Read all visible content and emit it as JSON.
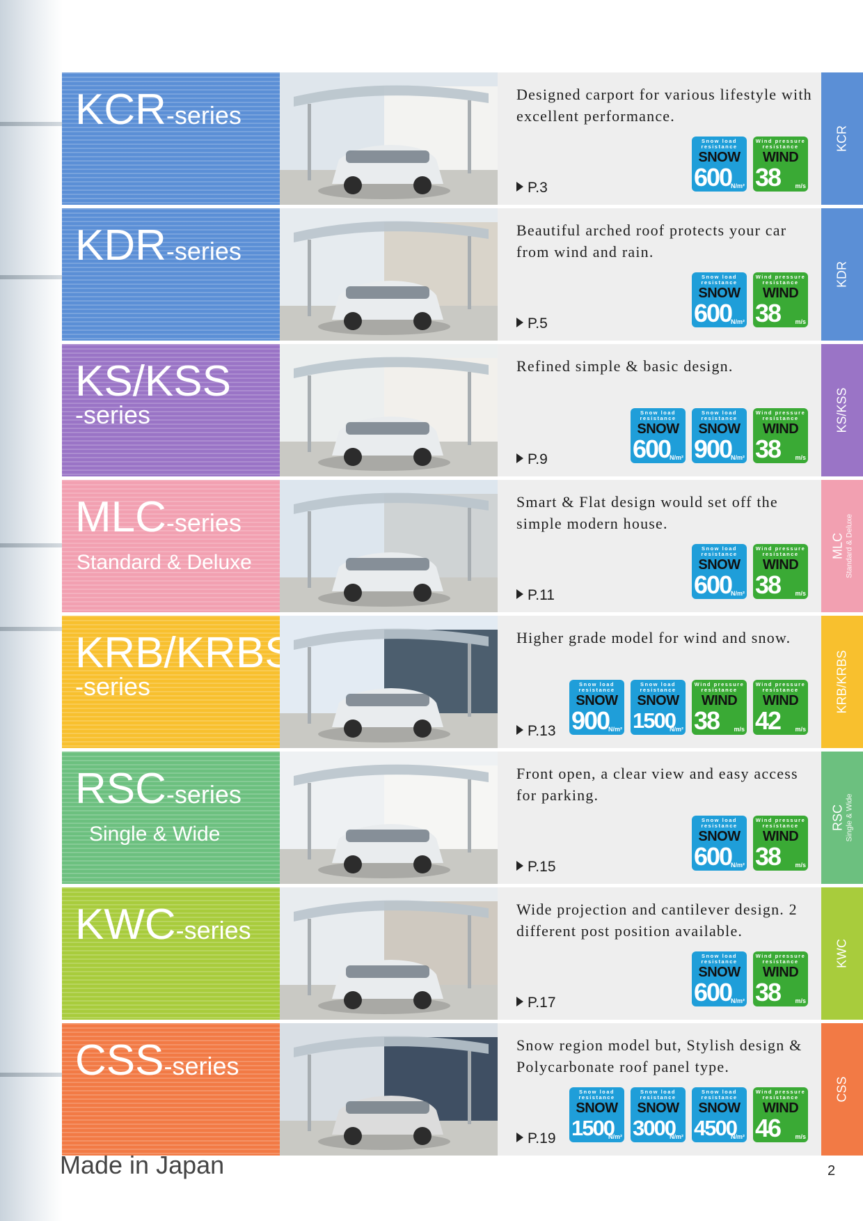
{
  "series": [
    {
      "name": "KCR",
      "suffix": "-series",
      "suffix_break": false,
      "subtitle": "",
      "tab": "KCR",
      "tab_sub": "",
      "color": "#5b8fd6",
      "description": "Designed carport for various lifestyle with excellent performance.",
      "page_ref": "P.3",
      "badges": [
        {
          "type": "snow",
          "caption": "Snow load resistance",
          "kind": "SNOW",
          "value": "600",
          "unit": "N/m²"
        },
        {
          "type": "wind",
          "caption": "Wind pressure resistance",
          "kind": "WIND",
          "value": "38",
          "unit": "m/s"
        }
      ]
    },
    {
      "name": "KDR",
      "suffix": "-series",
      "suffix_break": false,
      "subtitle": "",
      "tab": "KDR",
      "tab_sub": "",
      "color": "#5b8fd6",
      "description": "Beautiful arched roof protects your car from wind and rain.",
      "page_ref": "P.5",
      "badges": [
        {
          "type": "snow",
          "caption": "Snow load resistance",
          "kind": "SNOW",
          "value": "600",
          "unit": "N/m²"
        },
        {
          "type": "wind",
          "caption": "Wind pressure resistance",
          "kind": "WIND",
          "value": "38",
          "unit": "m/s"
        }
      ]
    },
    {
      "name": "KS/KSS",
      "suffix": "-series",
      "suffix_break": true,
      "subtitle": "",
      "tab": "KS/KSS",
      "tab_sub": "",
      "color": "#9a74c6",
      "description": "Refined simple & basic design.",
      "page_ref": "P.9",
      "badges": [
        {
          "type": "snow",
          "caption": "Snow load resistance",
          "kind": "SNOW",
          "value": "600",
          "unit": "N/m²"
        },
        {
          "type": "snow",
          "caption": "Snow load resistance",
          "kind": "SNOW",
          "value": "900",
          "unit": "N/m²"
        },
        {
          "type": "wind",
          "caption": "Wind pressure resistance",
          "kind": "WIND",
          "value": "38",
          "unit": "m/s"
        }
      ]
    },
    {
      "name": "MLC",
      "suffix": "-series",
      "suffix_break": false,
      "subtitle": "Standard & Deluxe",
      "tab": "MLC",
      "tab_sub": "Standard & Deluxe",
      "color": "#f2a0b1",
      "description": "Smart & Flat design would set off the simple modern house.",
      "page_ref": "P.11",
      "badges": [
        {
          "type": "snow",
          "caption": "Snow load resistance",
          "kind": "SNOW",
          "value": "600",
          "unit": "N/m²"
        },
        {
          "type": "wind",
          "caption": "Wind pressure resistance",
          "kind": "WIND",
          "value": "38",
          "unit": "m/s"
        }
      ]
    },
    {
      "name": "KRB/KRBS",
      "suffix": "-series",
      "suffix_break": true,
      "subtitle": "",
      "tab": "KRB/KRBS",
      "tab_sub": "",
      "color": "#f8c02e",
      "description": "Higher grade model for wind and snow.",
      "page_ref": "P.13",
      "badges": [
        {
          "type": "snow",
          "caption": "Snow load resistance",
          "kind": "SNOW",
          "value": "900",
          "unit": "N/m²"
        },
        {
          "type": "snow",
          "caption": "Snow load resistance",
          "kind": "SNOW",
          "value": "1500",
          "unit": "N/m²"
        },
        {
          "type": "wind",
          "caption": "Wind pressure resistance",
          "kind": "WIND",
          "value": "38",
          "unit": "m/s"
        },
        {
          "type": "wind",
          "caption": "Wind pressure resistance",
          "kind": "WIND",
          "value": "42",
          "unit": "m/s"
        }
      ]
    },
    {
      "name": "RSC",
      "suffix": "-series",
      "suffix_break": false,
      "subtitle": "Single & Wide",
      "tab": "RSC",
      "tab_sub": "Single & Wide",
      "color": "#6cc07f",
      "description": "Front open, a clear view and easy access for parking.",
      "page_ref": "P.15",
      "badges": [
        {
          "type": "snow",
          "caption": "Snow load resistance",
          "kind": "SNOW",
          "value": "600",
          "unit": "N/m²"
        },
        {
          "type": "wind",
          "caption": "Wind pressure resistance",
          "kind": "WIND",
          "value": "38",
          "unit": "m/s"
        }
      ]
    },
    {
      "name": "KWC",
      "suffix": "-series",
      "suffix_break": false,
      "subtitle": "",
      "tab": "KWC",
      "tab_sub": "",
      "color": "#a8cc3c",
      "description": "Wide projection and cantilever design. 2 different post position available.",
      "page_ref": "P.17",
      "badges": [
        {
          "type": "snow",
          "caption": "Snow load resistance",
          "kind": "SNOW",
          "value": "600",
          "unit": "N/m²"
        },
        {
          "type": "wind",
          "caption": "Wind pressure resistance",
          "kind": "WIND",
          "value": "38",
          "unit": "m/s"
        }
      ]
    },
    {
      "name": "CSS",
      "suffix": "-series",
      "suffix_break": false,
      "subtitle": "",
      "tab": "CSS",
      "tab_sub": "",
      "color": "#f27a45",
      "description": "Snow region model but, Stylish design & Polycarbonate roof panel type.",
      "page_ref": "P.19",
      "badges": [
        {
          "type": "snow",
          "caption": "Snow load resistance",
          "kind": "SNOW",
          "value": "1500",
          "unit": "N/m²"
        },
        {
          "type": "snow",
          "caption": "Snow load resistance",
          "kind": "SNOW",
          "value": "3000",
          "unit": "N/m²"
        },
        {
          "type": "snow",
          "caption": "Snow load resistance",
          "kind": "SNOW",
          "value": "4500",
          "unit": "N/m²"
        },
        {
          "type": "wind",
          "caption": "Wind pressure resistance",
          "kind": "WIND",
          "value": "46",
          "unit": "m/s"
        }
      ]
    }
  ],
  "footer": {
    "made_in": "Made in Japan",
    "page_number": "2"
  }
}
